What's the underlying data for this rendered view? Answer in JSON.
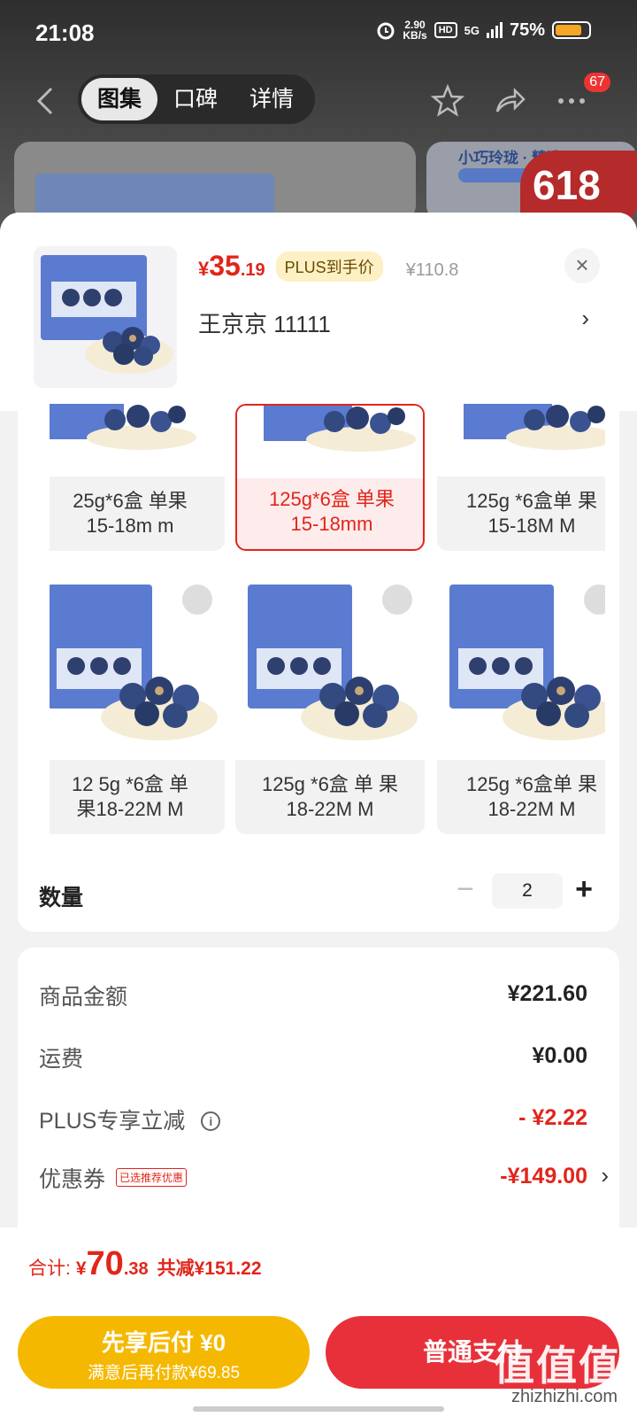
{
  "status_bar": {
    "time": "21:08",
    "net_speed_value": "2.90",
    "net_speed_unit": "KB/s",
    "hd": "HD",
    "network": "5G",
    "battery": "75%"
  },
  "nav": {
    "tabs": [
      {
        "label": "图集",
        "active": true
      },
      {
        "label": "口碑",
        "active": false
      },
      {
        "label": "详情",
        "active": false
      }
    ],
    "message_count": "67"
  },
  "background": {
    "card_subtitle": "小巧玲珑 · 精选",
    "badge": "618"
  },
  "product": {
    "price_symbol": "¥",
    "price_int": "35",
    "price_dec": ".19",
    "plus_tag": "PLUS到手价",
    "original_price": "¥110.8",
    "address": "王京京  11111",
    "close": "×",
    "arrow": "›"
  },
  "specs": [
    {
      "label": "125g*6盒 单果15-18m  m",
      "line1": "25g*6盒 单果",
      "line2": "15-18m  m",
      "selected": false
    },
    {
      "label": "125g*6盒 单果15-18mm",
      "line1": "125g*6盒 单果",
      "line2": "15-18mm",
      "selected": true
    },
    {
      "label": "125g *6盒单 果15-18M M",
      "line1": "125g *6盒单 果",
      "line2": "15-18M M",
      "selected": false
    },
    {
      "label": "12 5g *6盒 单果18-22M M",
      "line1": "12 5g *6盒 单",
      "line2": "果18-22M M",
      "selected": false
    },
    {
      "label": "125g *6盒 单 果18-22M M",
      "line1": "125g *6盒 单 果",
      "line2": "18-22M M",
      "selected": false
    },
    {
      "label": "125g *6盒单 果18-22M M",
      "line1": "125g *6盒单 果",
      "line2": "18-22M M",
      "selected": false
    }
  ],
  "quantity": {
    "label": "数量",
    "minus": "−",
    "value": "2",
    "plus": "+"
  },
  "fees": {
    "goods_label": "商品金额",
    "goods_value": "¥221.60",
    "shipping_label": "运费",
    "shipping_value": "¥0.00",
    "plus_label": "PLUS专享立减",
    "plus_info": "i",
    "plus_value": "- ¥2.22",
    "coupon_label": "优惠券",
    "coupon_tag": "已选推荐优惠",
    "coupon_value": "-¥149.00",
    "coupon_arrow": "›"
  },
  "total": {
    "label": "合计:",
    "symbol": "¥",
    "int": "70",
    "dec": ".38",
    "saving": "共减¥151.22"
  },
  "buttons": {
    "pay_later_main": "先享后付 ¥0",
    "pay_later_sub": "满意后再付款¥69.85",
    "pay_normal": "普通支付"
  },
  "watermark": {
    "text": "值值值",
    "url": "zhizhizhi.com"
  },
  "colors": {
    "accent_red": "#e1251b",
    "pay_later_yellow": "#f5b800",
    "pay_normal_red": "#e8303a"
  }
}
